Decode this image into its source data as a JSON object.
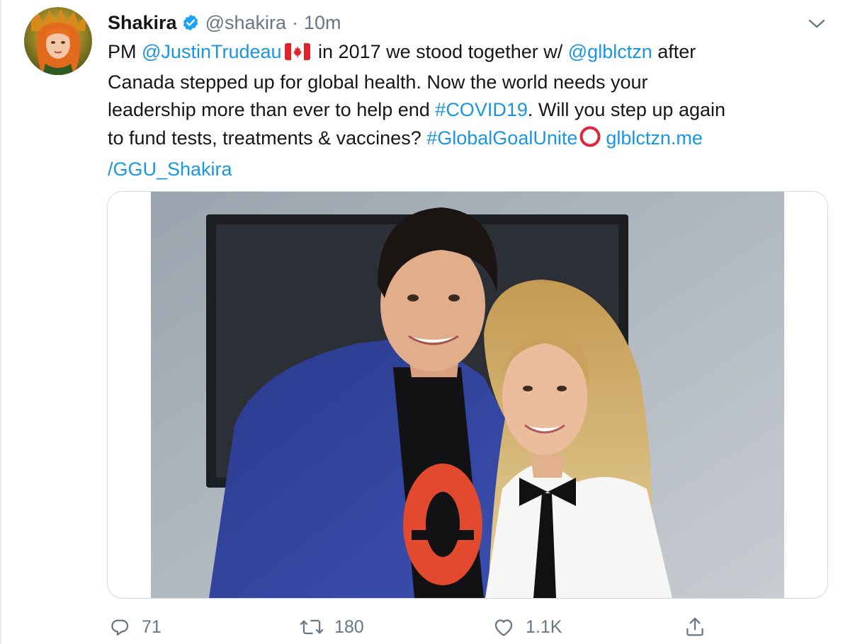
{
  "tweet": {
    "author": {
      "name": "Shakira",
      "handle": "@shakira",
      "separator": "·",
      "time": "10m",
      "verified": true
    },
    "text": {
      "line1": {
        "pre": "PM ",
        "mention1": "@JustinTrudeau",
        "flag_icon": "canada-flag-icon",
        "mid": " in 2017 we stood together w/ ",
        "mention2": "@glblctzn",
        "post": " after"
      },
      "line2": "Canada stepped up for global health. Now the world needs your",
      "line3": {
        "pre": "leadership more than ever to help end ",
        "hashtag": "#COVID19",
        "post": ". Will you step up again"
      },
      "line4": {
        "pre": "to fund tests, treatments & vaccines? ",
        "hashtag": "#GlobalGoalUnite",
        "emoji_icon": "red-ring-icon",
        "space": " ",
        "link_part1": "glblctzn.me"
      },
      "line5": {
        "link_part2": "/GGU_Shakira"
      }
    },
    "media": {
      "type": "photo",
      "icon": "photo-two-people-image"
    },
    "actions": {
      "reply": {
        "icon": "reply-icon",
        "count": "71"
      },
      "retweet": {
        "icon": "retweet-icon",
        "count": "180"
      },
      "like": {
        "icon": "heart-icon",
        "count": "1.1K"
      },
      "share": {
        "icon": "share-icon"
      }
    },
    "menu_icon": "chevron-down-icon"
  },
  "colors": {
    "link": "#1b95e0",
    "secondary": "#657786",
    "verified": "#1da1f2",
    "border": "#cfd9de"
  }
}
